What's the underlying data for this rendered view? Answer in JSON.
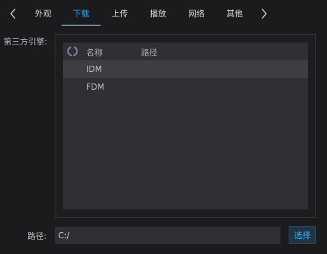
{
  "tabs": [
    {
      "label": "外观",
      "active": false
    },
    {
      "label": "下载",
      "active": true
    },
    {
      "label": "上传",
      "active": false
    },
    {
      "label": "播放",
      "active": false
    },
    {
      "label": "网络",
      "active": false
    },
    {
      "label": "其他",
      "active": false
    }
  ],
  "engine_section": {
    "label": "第三方引擎:",
    "columns": [
      "名称",
      "路径"
    ],
    "rows": [
      {
        "name": "IDM",
        "path": "",
        "selected": true
      },
      {
        "name": "FDM",
        "path": "",
        "selected": false
      }
    ]
  },
  "path_field": {
    "label": "路径:",
    "value": "C:/"
  },
  "choose_button": {
    "label": "选择"
  },
  "colors": {
    "accent": "#3b9ee8",
    "background": "#1b1b1e",
    "table_bg": "#2f2f34",
    "selected_row": "#3d3d42",
    "header_icon": "#8a7fb3"
  },
  "icons": [
    "chevron-left-icon",
    "chevron-right-icon",
    "laurel-icon"
  ]
}
